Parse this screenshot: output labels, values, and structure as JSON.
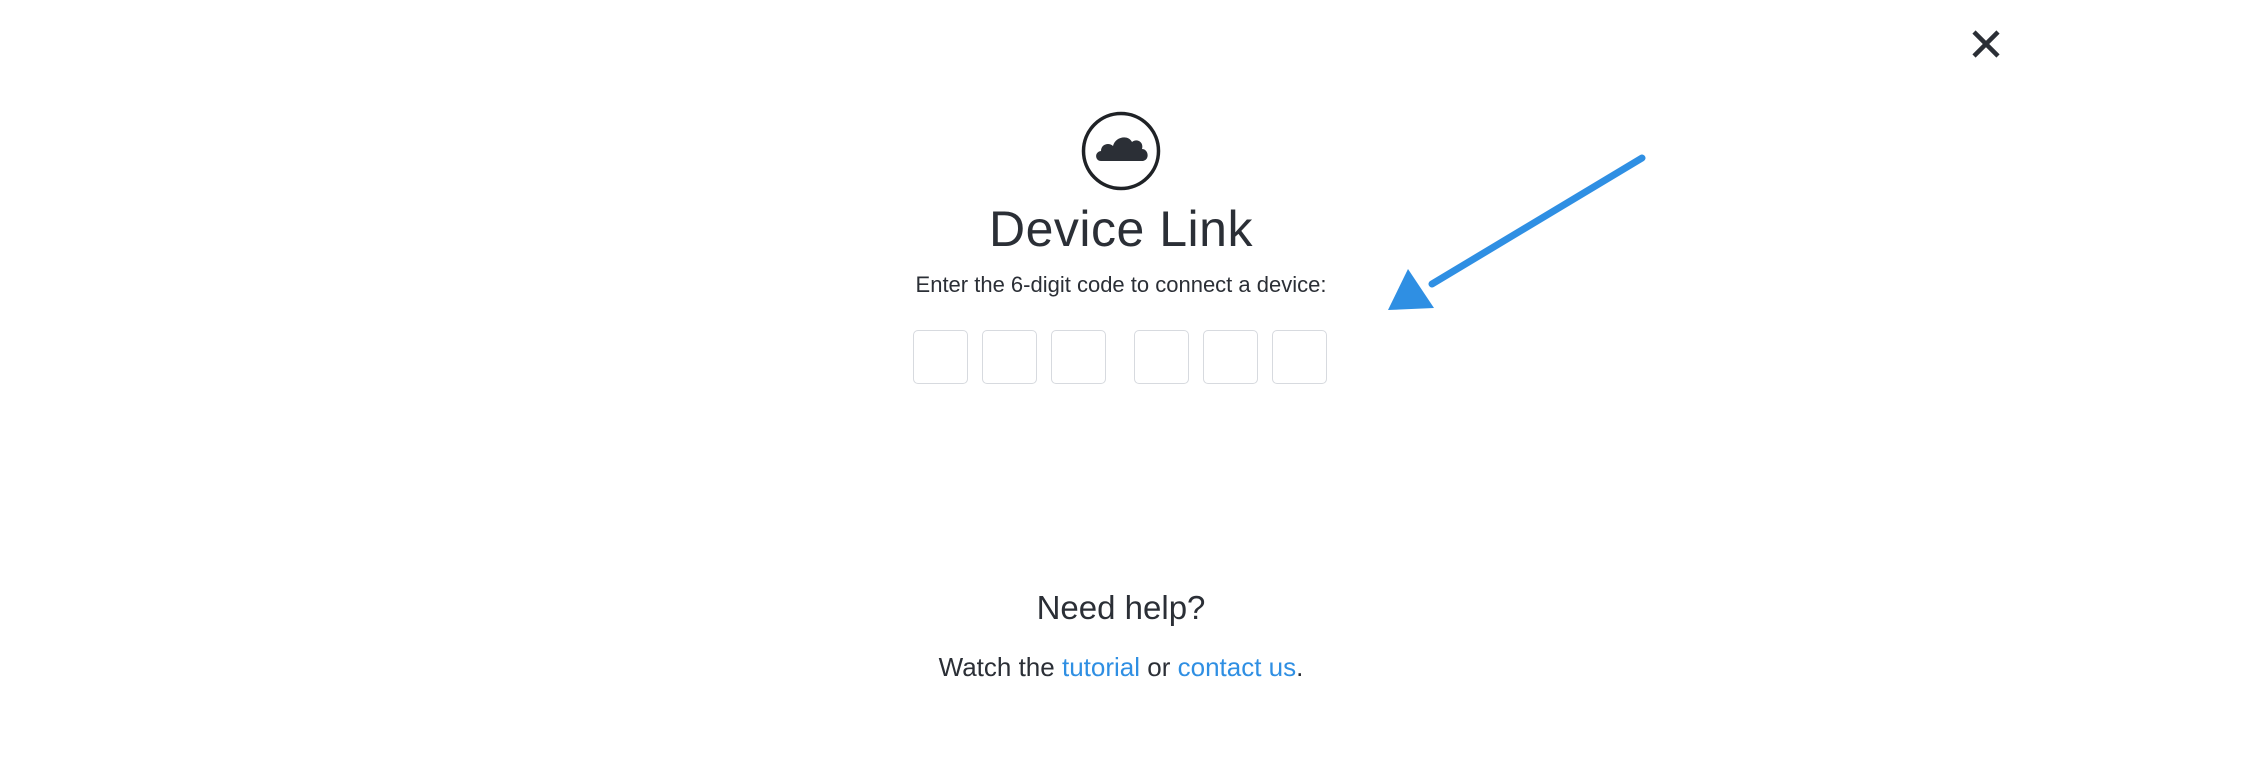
{
  "header": {
    "close_icon": "close-icon"
  },
  "logo": {
    "icon": "cloud-icon"
  },
  "title": "Device Link",
  "subtitle": "Enter the 6-digit code to connect a device:",
  "code": {
    "digits": [
      "",
      "",
      "",
      "",
      "",
      ""
    ]
  },
  "annotation": {
    "icon": "arrow-icon",
    "color": "#2f8fe3"
  },
  "help": {
    "title": "Need help?",
    "prefix": "Watch the",
    "tutorial_link": "tutorial",
    "middle": "or",
    "contact_link": "contact us",
    "suffix": "."
  },
  "colors": {
    "text": "#2b2f36",
    "link": "#2f8fe3",
    "box_border": "#d7dadf"
  }
}
